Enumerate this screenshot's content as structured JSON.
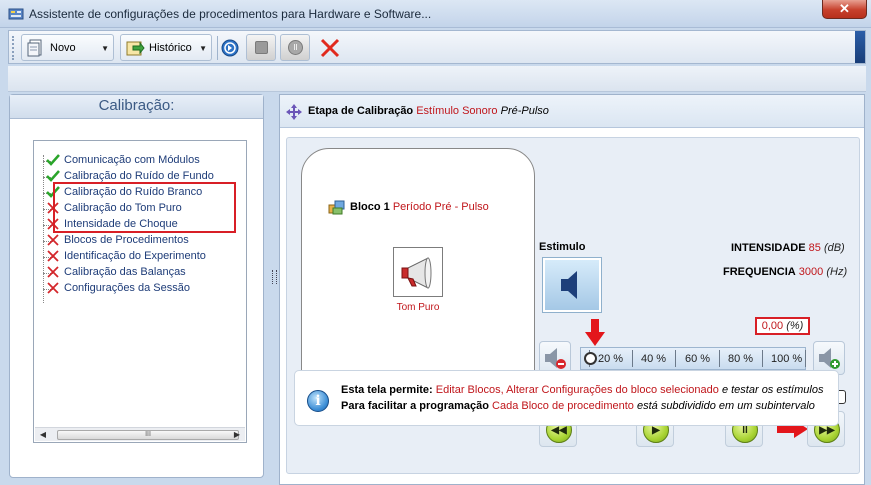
{
  "window": {
    "title": "Assistente de configurações de procedimentos para Hardware e Software..."
  },
  "toolbar": {
    "novo_label": "Novo",
    "historico_label": "Histórico"
  },
  "left_panel": {
    "title": "Calibração:",
    "items": [
      {
        "label": "Comunicação com Módulos",
        "status": "check"
      },
      {
        "label": "Calibração do Ruído de Fundo",
        "status": "check"
      },
      {
        "label": "Calibração do Ruído Branco",
        "status": "check"
      },
      {
        "label": "Calibração do Tom Puro",
        "status": "x"
      },
      {
        "label": "Intensidade de Choque",
        "status": "x"
      },
      {
        "label": "Blocos de Procedimentos",
        "status": "x"
      },
      {
        "label": "Identificação do Experimento",
        "status": "x"
      },
      {
        "label": "Calibração das Balanças",
        "status": "x"
      },
      {
        "label": "Configurações da Sessão",
        "status": "x"
      }
    ],
    "scroll_thumb_glyph": "III"
  },
  "header": {
    "bold": "Etapa de Calibração",
    "red": "Estímulo",
    "red2": "Sonoro",
    "italic": "Pré-Pulso"
  },
  "bloco": {
    "label_bold": "Bloco",
    "number": "1",
    "period": "Período Pré - Pulso",
    "tom_label": "Tom Puro"
  },
  "stimulus": {
    "label": "Estimulo",
    "intensidade_label": "INTENSIDADE",
    "intensidade_value": "85",
    "intensidade_unit": "(dB)",
    "frequencia_label": "FREQUENCIA",
    "frequencia_value": "3000",
    "frequencia_unit": "(Hz)",
    "percent_value": "0,00",
    "percent_unit": "(%)",
    "slider_value_percent": 0,
    "slider_ticks": [
      "20 %",
      "40 %",
      "60 %",
      "80 %",
      "100 %"
    ],
    "progress_fraction": 0
  },
  "info": {
    "line1_bold": "Esta tela permite:",
    "line1_red": "Editar Blocos, Alterar Configurações do bloco selecionado",
    "line1_italic": "e testar os estímulos",
    "line2_bold": "Para facilitar a programação",
    "line2_red": "Cada Bloco de procedimento",
    "line2_italic": "está subdividido em um subintervalo"
  },
  "colors": {
    "accent_red": "#c0161b",
    "highlight_box": "#d81f26",
    "check_green": "#2aa52a"
  }
}
